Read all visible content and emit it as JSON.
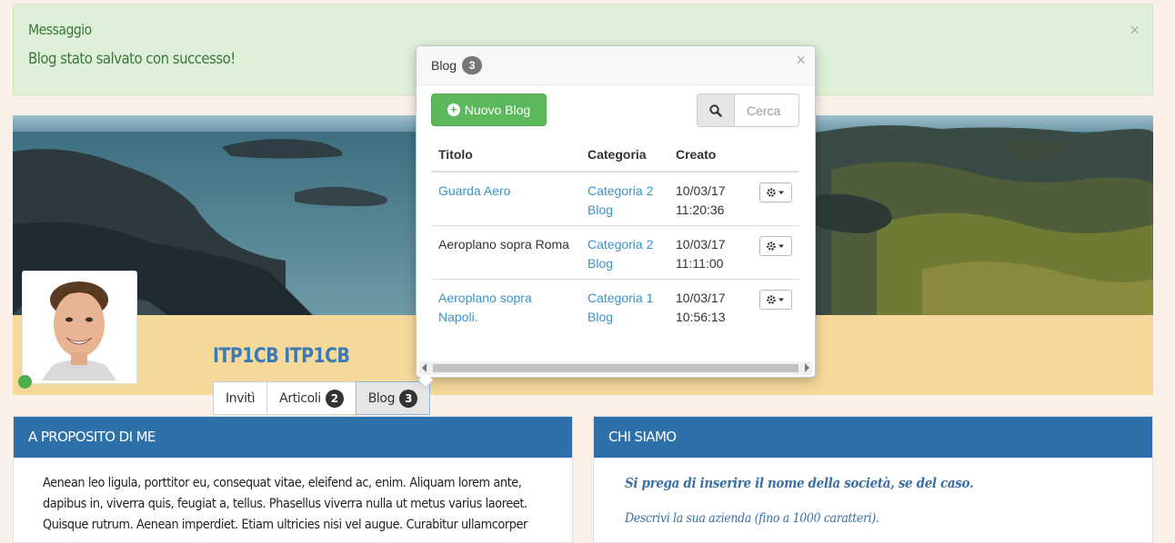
{
  "alert": {
    "title": "Messaggio",
    "message": "Blog stato salvato con successo!",
    "close": "×"
  },
  "profile": {
    "name": "ITP1CB ITP1CB",
    "status_color": "#4cae4c"
  },
  "tabs": [
    {
      "label": "Invitì",
      "count": null
    },
    {
      "label": "Articoli",
      "count": "2"
    },
    {
      "label": "Blog",
      "count": "3",
      "active": true
    }
  ],
  "popover": {
    "title": "Blog",
    "count": "3",
    "close": "×",
    "new_button": "Nuovo Blog",
    "search_placeholder": "Cerca",
    "columns": [
      "Titolo",
      "Categoria",
      "Creato"
    ],
    "rows": [
      {
        "title": "Guarda Aero",
        "title_linked": true,
        "category": "Categoria 2 Blog",
        "date": "10/03/17",
        "time": "11:20:36"
      },
      {
        "title": "Aeroplano sopra Roma",
        "title_linked": false,
        "category": "Categoria 2 Blog",
        "date": "10/03/17",
        "time": "11:11:00"
      },
      {
        "title": "Aeroplano sopra Napoli.",
        "title_linked": true,
        "category": "Categoria 1 Blog",
        "date": "10/03/17",
        "time": "10:56:13"
      }
    ],
    "row_action_icon": "gear-icon"
  },
  "about": {
    "heading": "A PROPOSITO DI ME",
    "lines": [
      "Aenean leo ligula, porttitor eu, consequat vitae, eleifend ac, enim. Aliquam lorem ante,",
      "dapibus in, viverra quis, feugiat a, tellus. Phasellus viverra nulla ut metus varius laoreet.",
      "Quisque rutrum. Aenean imperdiet. Etiam ultricies nisi vel augue. Curabitur ullamcorper"
    ]
  },
  "company": {
    "heading": "CHI SIAMO",
    "prompt": "Si prega di inserire il nome della società, se del caso.",
    "description": "Descrivi la sua azienda (fino a 1000 caratteri)."
  },
  "colors": {
    "alert_bg": "#dff0d8",
    "panel_header": "#2e70aa",
    "primary_text": "#3a7bb5",
    "success": "#5cb85c",
    "band": "#f5d99b"
  }
}
